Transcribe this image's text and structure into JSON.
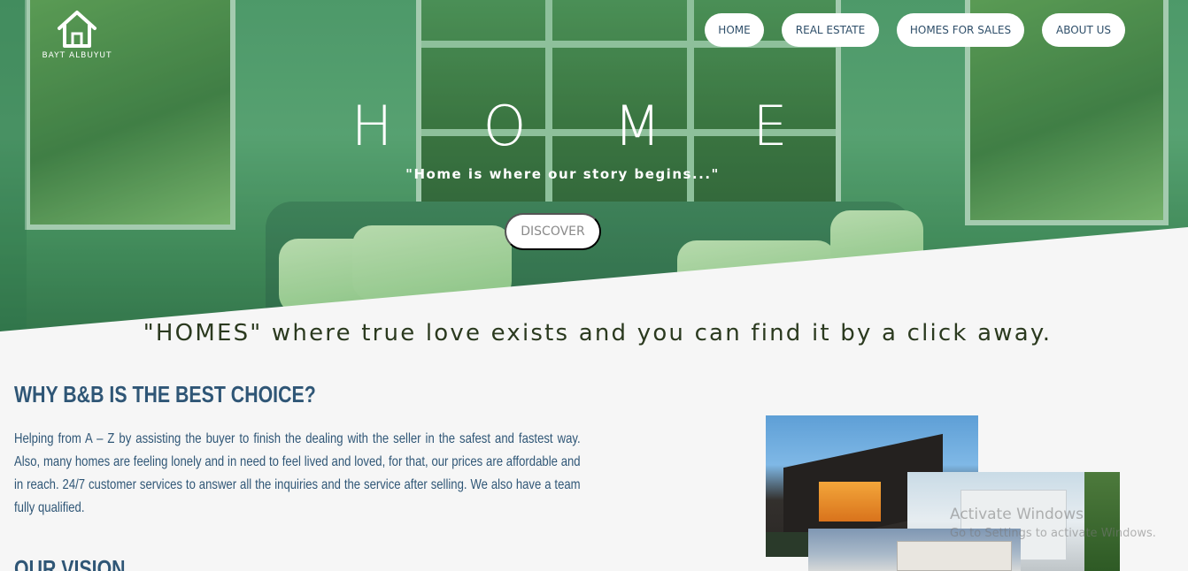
{
  "brand": {
    "name": "BAYT ALBUYUT"
  },
  "nav": [
    {
      "label": "HOME"
    },
    {
      "label": "REAL ESTATE"
    },
    {
      "label": "HOMES FOR SALES"
    },
    {
      "label": "ABOUT US"
    }
  ],
  "hero": {
    "letters": [
      "H",
      "O",
      "M",
      "E"
    ],
    "tagline": "\"Home is where our story begins...\"",
    "button": "DISCOVER"
  },
  "quote": "\"HOMES\" where true love exists and you can find it by a click away.",
  "why": {
    "title": "WHY B&B IS THE BEST CHOICE?",
    "body": "Helping from A – Z by assisting the buyer to finish the dealing with the seller in the safest and fastest way. Also, many homes are feeling lonely and in need to feel lived and loved, for that, our prices are affordable and in reach. 24/7 customer services to answer all the inquiries and the service after selling. We also have a team fully qualified."
  },
  "vision": {
    "title": "OUR VISION"
  },
  "watermark": {
    "line1": "Activate Windows",
    "line2": "Go to Settings to activate Windows."
  },
  "colors": {
    "accent": "#2f5676",
    "hero_green": "#4f9a6b"
  },
  "icons": [
    "house-icon"
  ]
}
